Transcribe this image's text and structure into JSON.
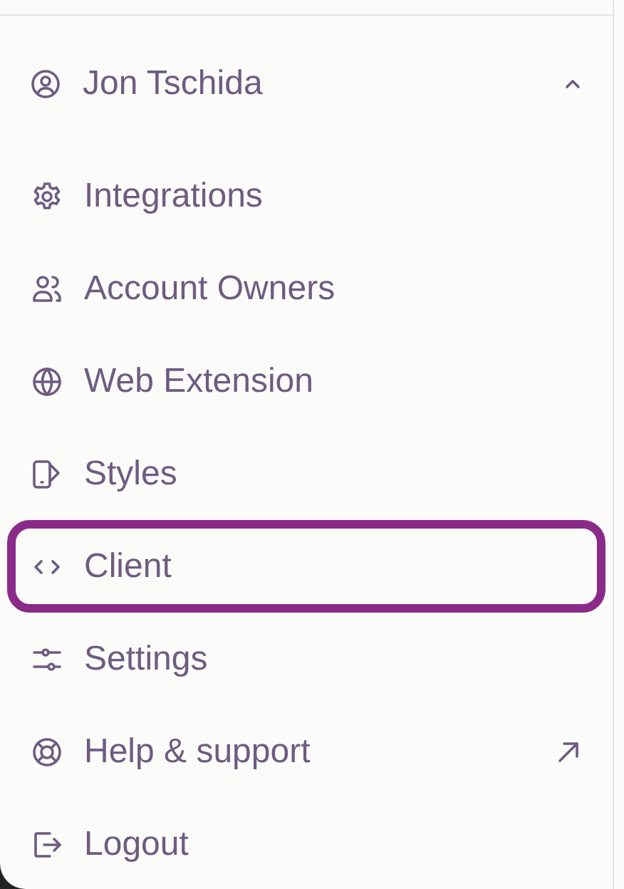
{
  "account": {
    "name": "Jon Tschida",
    "expanded": true
  },
  "menu_items": [
    {
      "kind": "integrations",
      "label": "Integrations",
      "highlighted": false,
      "external": false
    },
    {
      "kind": "owners",
      "label": "Account Owners",
      "highlighted": false,
      "external": false
    },
    {
      "kind": "web",
      "label": "Web Extension",
      "highlighted": false,
      "external": false
    },
    {
      "kind": "styles",
      "label": "Styles",
      "highlighted": false,
      "external": false
    },
    {
      "kind": "client",
      "label": "Client",
      "highlighted": true,
      "external": false
    },
    {
      "kind": "settings",
      "label": "Settings",
      "highlighted": false,
      "external": false
    },
    {
      "kind": "help",
      "label": "Help & support",
      "highlighted": false,
      "external": true
    },
    {
      "kind": "logout",
      "label": "Logout",
      "highlighted": false,
      "external": false
    }
  ]
}
